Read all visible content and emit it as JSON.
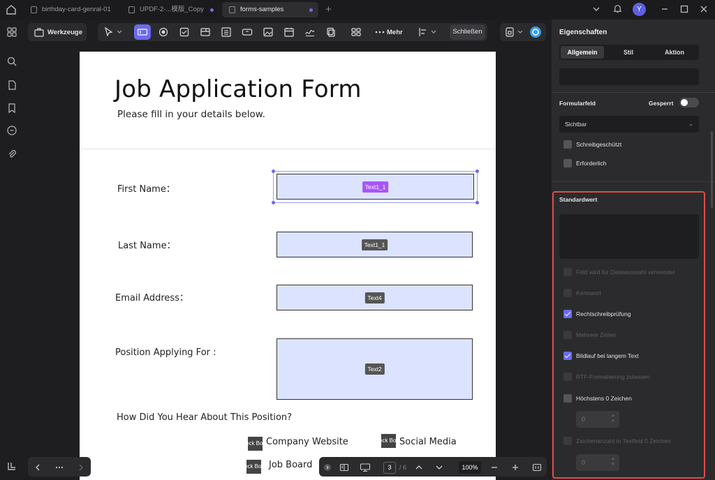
{
  "tabs": [
    {
      "label": "birthday-card-genral-01",
      "active": false,
      "unsaved": false
    },
    {
      "label": "UPDF-2-...模版_Copy",
      "active": false,
      "unsaved": true
    },
    {
      "label": "forms-samples",
      "active": true,
      "unsaved": true
    }
  ],
  "window": {
    "avatar_letter": "Y"
  },
  "toolbar": {
    "tools_label": "Werkzeuge",
    "more_label": "Mehr",
    "close_label": "Schließen"
  },
  "form": {
    "title": "Job Application Form",
    "subtitle": "Please fill in your details below.",
    "fields": [
      {
        "label": "First Name：",
        "tag": "Text1_1",
        "selected": true
      },
      {
        "label": "Last Name：",
        "tag": "Text1_1",
        "selected": false
      },
      {
        "label": "Email Address：",
        "tag": "Text4",
        "selected": false
      },
      {
        "label": "Position Applying For :",
        "tag": "Text2",
        "selected": false
      }
    ],
    "question": "How Did You Hear About This Position?",
    "checkbox_tag": "eck Bo",
    "options": [
      "Company Website",
      "Social Media",
      "Job Board"
    ]
  },
  "bottom": {
    "current_page": "3",
    "total_pages": "/ 6",
    "zoom": "100%"
  },
  "panel": {
    "title": "Eigenschaften",
    "tabs": [
      "Allgemein",
      "Stil",
      "Aktion"
    ],
    "formfield_label": "Formularfeld",
    "locked_label": "Gesperrt",
    "visibility": "Sichtbar",
    "readonly_label": "Schreibgeschützt",
    "required_label": "Erforderlich",
    "default_label": "Standardwert",
    "options": [
      {
        "label": "Feld wird für Dateiauswahl verwendet",
        "checked": false,
        "enabled": false
      },
      {
        "label": "Kennwort",
        "checked": false,
        "enabled": false
      },
      {
        "label": "Rechtschreibprüfung",
        "checked": true,
        "enabled": true
      },
      {
        "label": "Mehrere Zeilen",
        "checked": false,
        "enabled": false
      },
      {
        "label": "Bildlauf bei langem Text",
        "checked": true,
        "enabled": true
      },
      {
        "label": "RTF-Formatierung zulassen",
        "checked": false,
        "enabled": false
      },
      {
        "label": "Höchstens 0 Zeichen",
        "checked": false,
        "enabled": true
      },
      {
        "label": "Zeichenanzahl in Textfeld 0 Zeichen",
        "checked": false,
        "enabled": false
      }
    ],
    "max_chars_value": "0",
    "comb_value": "0"
  }
}
